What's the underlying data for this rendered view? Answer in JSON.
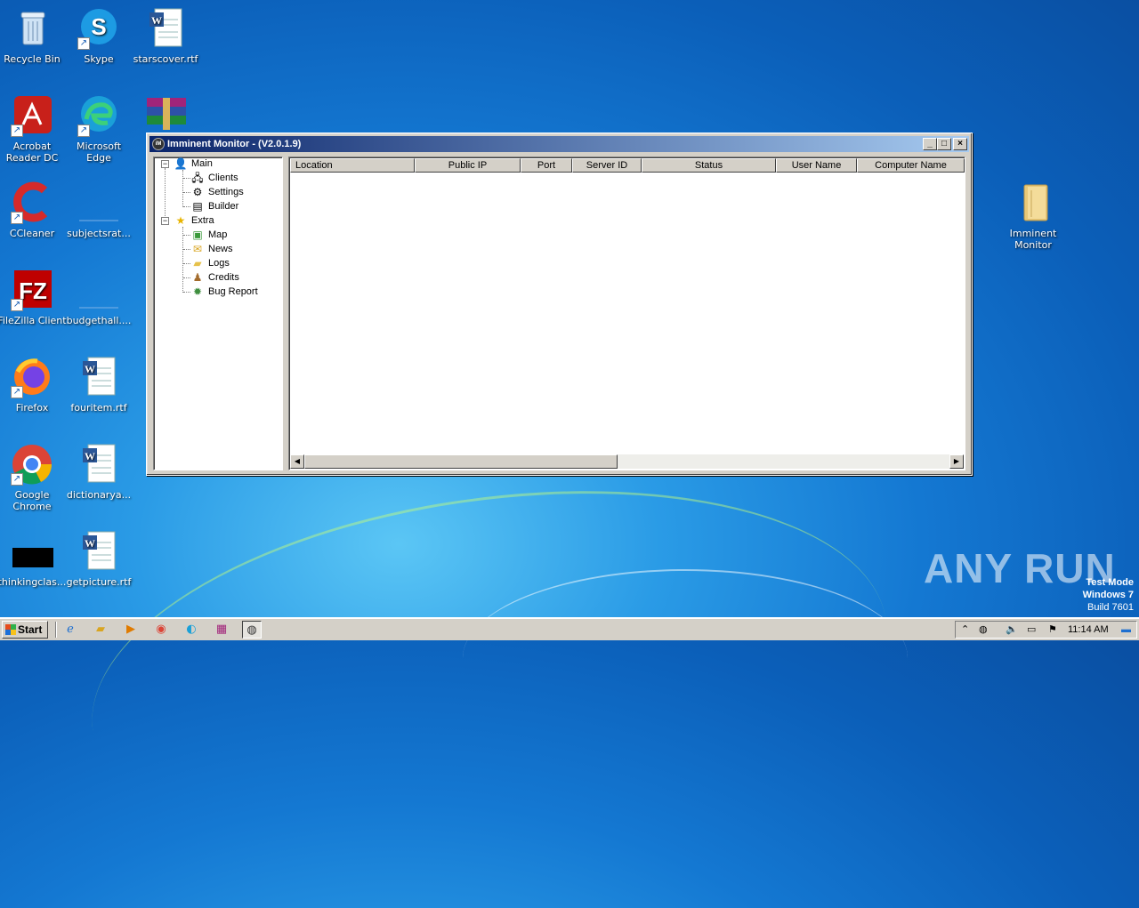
{
  "desktop": {
    "icons": [
      {
        "label": "Recycle Bin",
        "icon": "recycle-bin-icon"
      },
      {
        "label": "Skype",
        "icon": "skype-icon"
      },
      {
        "label": "starscover.rtf",
        "icon": "word-document-icon"
      },
      {
        "label": "Acrobat Reader DC",
        "icon": "acrobat-icon"
      },
      {
        "label": "Microsoft Edge",
        "icon": "edge-icon"
      },
      {
        "label": "CCleaner",
        "icon": "ccleaner-icon"
      },
      {
        "label": "subjectsrat...",
        "icon": "blank-file-icon"
      },
      {
        "label": "FileZilla Client",
        "icon": "filezilla-icon"
      },
      {
        "label": "budgethall....",
        "icon": "blank-file-icon"
      },
      {
        "label": "Firefox",
        "icon": "firefox-icon"
      },
      {
        "label": "fouritem.rtf",
        "icon": "word-document-icon"
      },
      {
        "label": "Google Chrome",
        "icon": "chrome-icon"
      },
      {
        "label": "dictionarya...",
        "icon": "word-document-icon"
      },
      {
        "label": "thinkingclas...",
        "icon": "black-file-icon"
      },
      {
        "label": "getpicture.rtf",
        "icon": "word-document-icon"
      },
      {
        "label": "Imminent Monitor",
        "icon": "folder-icon"
      }
    ],
    "watermark": "ANY RUN",
    "test_mode": [
      "Test Mode",
      "Windows 7",
      "Build 7601"
    ]
  },
  "window": {
    "title": "Imminent Monitor - (V2.0.1.9)",
    "app_icon_text": "iM",
    "tree": {
      "main": "Main",
      "main_children": [
        "Clients",
        "Settings",
        "Builder"
      ],
      "extra": "Extra",
      "extra_children": [
        "Map",
        "News",
        "Logs",
        "Credits",
        "Bug Report"
      ]
    },
    "columns": [
      "Location",
      "Public IP",
      "Port",
      "Server ID",
      "Status",
      "User Name",
      "Computer Name"
    ]
  },
  "taskbar": {
    "start_label": "Start",
    "clock": "11:14 AM"
  }
}
